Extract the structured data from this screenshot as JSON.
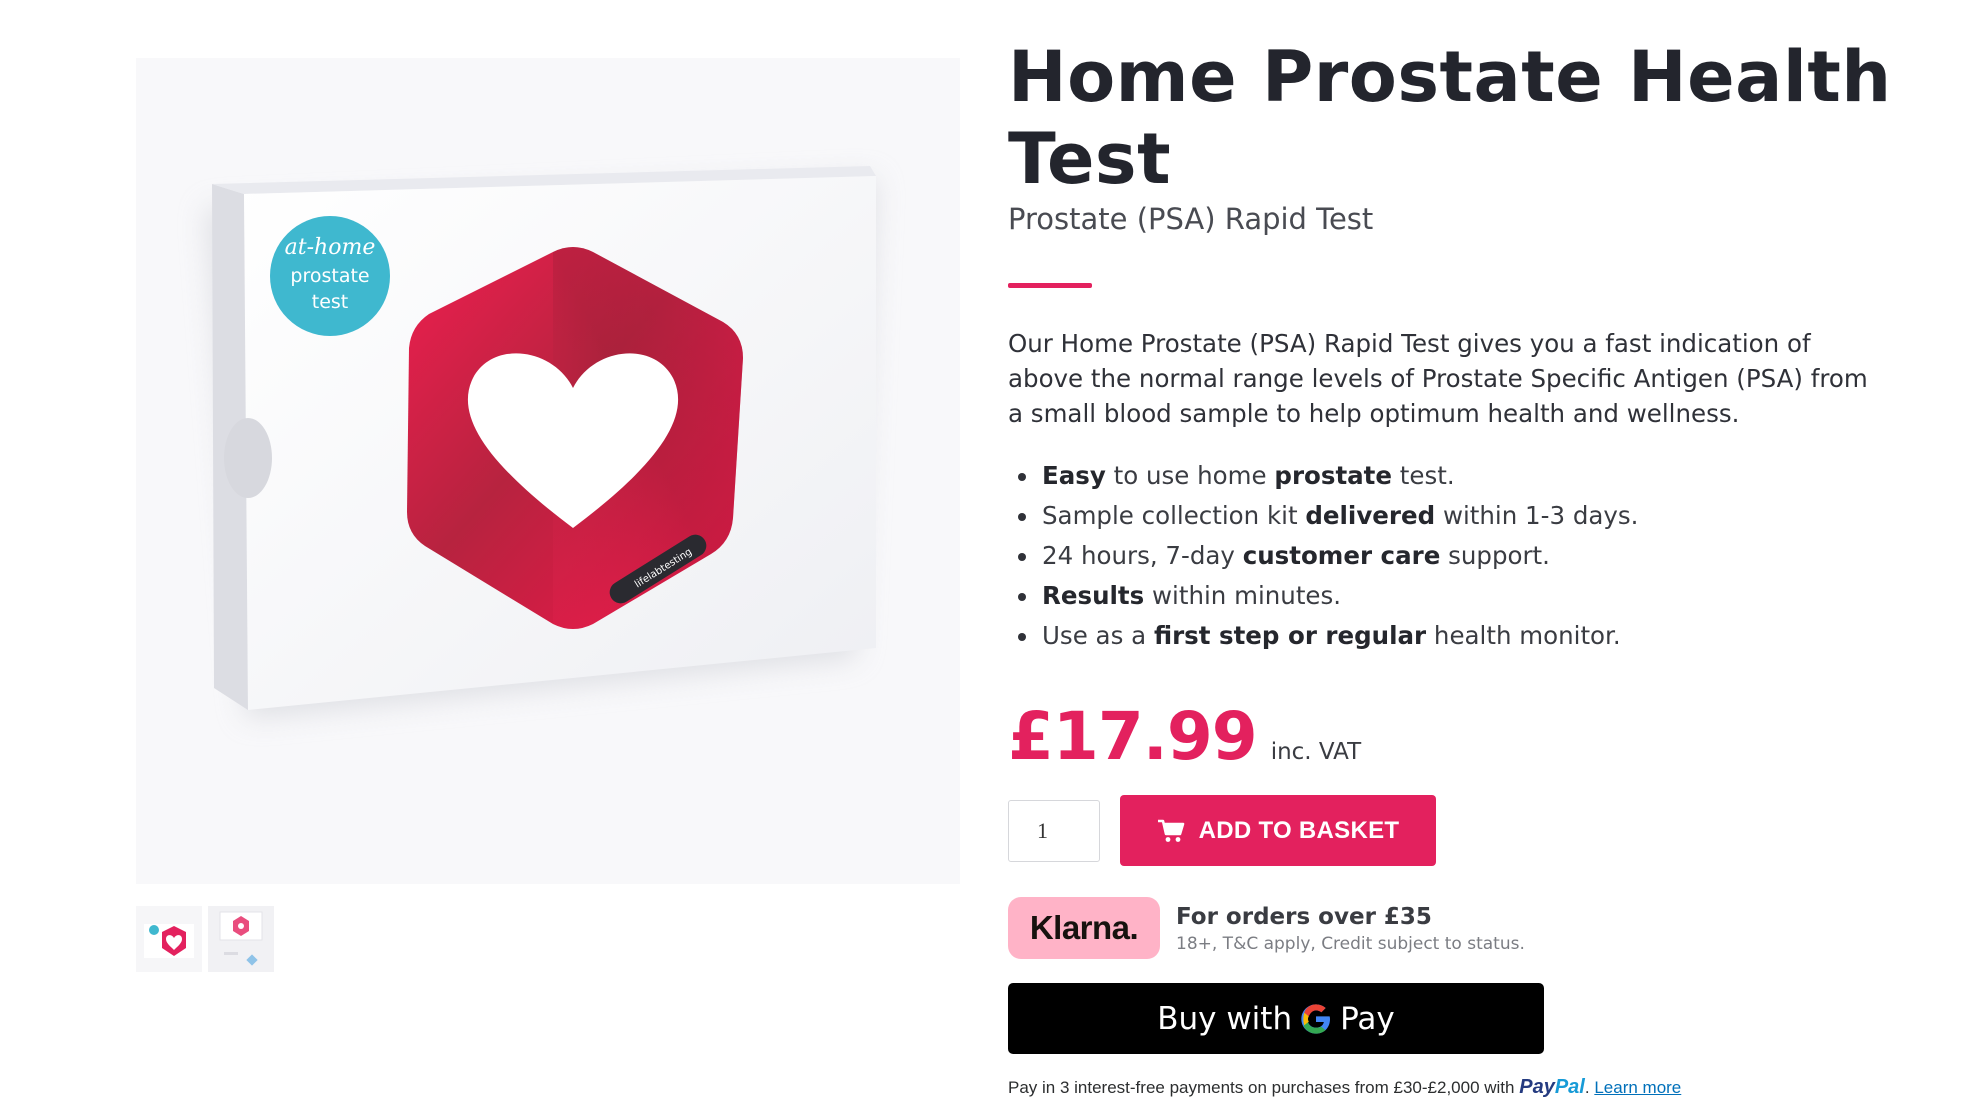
{
  "product": {
    "title": "Home Prostate Health Test",
    "subtitle": "Prostate (PSA) Rapid Test",
    "description": "Our Home Prostate (PSA) Rapid Test gives you a fast indication of above the normal range levels of Prostate Specific Antigen (PSA) from a small blood sample to help optimum health and wellness.",
    "features": [
      [
        {
          "t": "Easy",
          "b": true
        },
        {
          "t": " to use home "
        },
        {
          "t": "prostate",
          "b": true
        },
        {
          "t": " test."
        }
      ],
      [
        {
          "t": "Sample collection kit "
        },
        {
          "t": "delivered",
          "b": true
        },
        {
          "t": " within 1-3 days."
        }
      ],
      [
        {
          "t": "24 hours, 7-day "
        },
        {
          "t": "customer care",
          "b": true
        },
        {
          "t": " support."
        }
      ],
      [
        {
          "t": "Results",
          "b": true
        },
        {
          "t": " within minutes."
        }
      ],
      [
        {
          "t": "Use as a "
        },
        {
          "t": "first step or regular",
          "b": true
        },
        {
          "t": " health monitor."
        }
      ]
    ],
    "price": "£17.99",
    "vat_note": "inc. VAT",
    "quantity": "1",
    "add_to_basket_label": "ADD TO BASKET"
  },
  "gallery": {
    "badge_text": [
      "at-home",
      "prostate",
      "test"
    ],
    "box_brand": "lifelabtesting",
    "thumbnail_count": 2
  },
  "klarna": {
    "logo": "Klarna.",
    "headline": "For orders over £35",
    "subtext": "18+, T&C apply, Credit subject to status."
  },
  "gpay": {
    "label": "Buy with",
    "pay": "Pay"
  },
  "paypal": {
    "text": "Pay in 3 interest-free payments on purchases from £30-£2,000 with",
    "logo_part1": "Pay",
    "logo_part2": "Pal",
    "learn_more": "Learn more"
  },
  "colors": {
    "accent": "#e3215e",
    "klarna_pink": "#ffb3c7",
    "badge_teal": "#3fb8cf",
    "paypal_dark": "#253b80",
    "paypal_light": "#179bd7",
    "link": "#0070ba"
  },
  "icons": [
    "cart-icon",
    "google-g-icon"
  ]
}
